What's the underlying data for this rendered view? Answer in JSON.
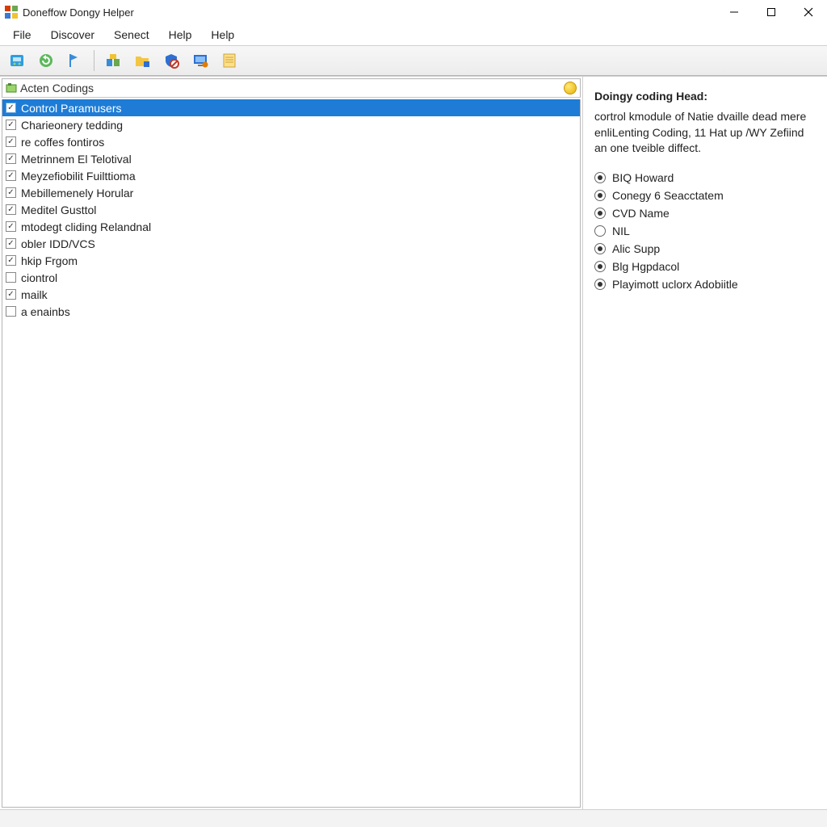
{
  "window": {
    "title": "Doneffow Dongy Helper"
  },
  "menu": [
    "File",
    "Discover",
    "Senect",
    "Help",
    "Help"
  ],
  "panel": {
    "title": "Acten Codings"
  },
  "list_items": [
    {
      "label": "Control Paramusers",
      "checked": true,
      "selected": true
    },
    {
      "label": "Charieonery tedding",
      "checked": true,
      "selected": false
    },
    {
      "label": "re coffes fontiros",
      "checked": true,
      "selected": false
    },
    {
      "label": "Metrinnem El Telotival",
      "checked": true,
      "selected": false
    },
    {
      "label": "Meyzefiobilit Fuilttioma",
      "checked": true,
      "selected": false
    },
    {
      "label": "Mebillemenely Horular",
      "checked": true,
      "selected": false
    },
    {
      "label": "Meditel Gusttol",
      "checked": true,
      "selected": false
    },
    {
      "label": "mtodegt cliding Relandnal",
      "checked": true,
      "selected": false
    },
    {
      "label": "obler IDD/VCS",
      "checked": true,
      "selected": false
    },
    {
      "label": "hkip Frgom",
      "checked": true,
      "selected": false
    },
    {
      "label": "ciontrol",
      "checked": false,
      "selected": false
    },
    {
      "label": "mailk",
      "checked": true,
      "selected": false
    },
    {
      "label": "a enainbs",
      "checked": false,
      "selected": false
    }
  ],
  "details": {
    "heading": "Doingy coding Head:",
    "description": "cortrol kmodule of Natie dvaille dead mere enliLenting Coding, 11 Hat up /WY Zefiind an one tveible diffect.",
    "options": [
      {
        "label": "BIQ Howard",
        "on": true
      },
      {
        "label": "Conegy 6 Seacctatem",
        "on": true
      },
      {
        "label": "CVD Name",
        "on": true
      },
      {
        "label": "NIL",
        "on": false
      },
      {
        "label": "Alic Supp",
        "on": true
      },
      {
        "label": "Blg Hgpdacol",
        "on": true
      },
      {
        "label": "Playimott uclorx Adobiitle",
        "on": true
      }
    ]
  }
}
